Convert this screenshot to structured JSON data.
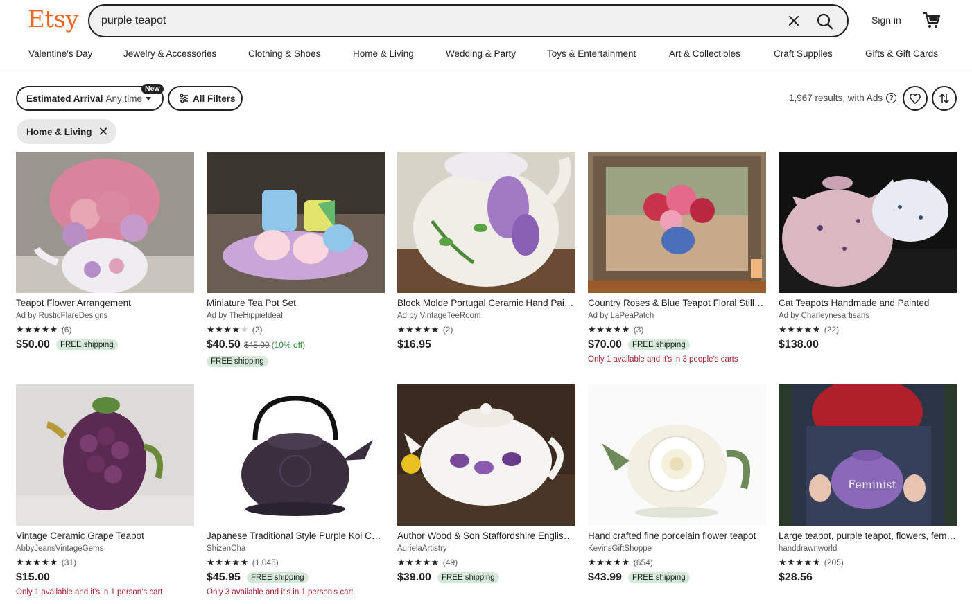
{
  "header": {
    "logo": "Etsy",
    "search_value": "purple teapot",
    "sign_in": "Sign in"
  },
  "nav": [
    "Valentine's Day",
    "Jewelry & Accessories",
    "Clothing & Shoes",
    "Home & Living",
    "Wedding & Party",
    "Toys & Entertainment",
    "Art & Collectibles",
    "Craft Supplies",
    "Gifts & Gift Cards"
  ],
  "filters": {
    "estimated_label": "Estimated Arrival",
    "estimated_value": "Any time",
    "new_badge": "New",
    "all_filters": "All Filters",
    "results_text": "1,967 results, with Ads",
    "chip": "Home & Living"
  },
  "listings": [
    {
      "title": "Teapot Flower Arrangement",
      "shop": "Ad by RusticFlareDesigns",
      "rating": 5,
      "reviews": "(6)",
      "price": "$50.00",
      "free_shipping": "FREE shipping"
    },
    {
      "title": "Miniature Tea Pot Set",
      "shop": "Ad by TheHippieIdeal",
      "rating": 4,
      "reviews": "(2)",
      "price": "$40.50",
      "original_price": "$45.00",
      "discount": "(10% off)",
      "free_shipping": "FREE shipping"
    },
    {
      "title": "Block Molde Portugal Ceramic Hand Painted Teapot",
      "shop": "Ad by VintageTeeRoom",
      "rating": 5,
      "reviews": "(2)",
      "price": "$16.95"
    },
    {
      "title": "Country Roses & Blue Teapot Floral Still Life",
      "shop": "Ad by LaPeaPatch",
      "rating": 5,
      "reviews": "(3)",
      "price": "$70.00",
      "free_shipping": "FREE shipping",
      "availability": "Only 1 available and it's in 3 people's carts"
    },
    {
      "title": "Cat Teapots Handmade and Painted",
      "shop": "Ad by Charleynesartisans",
      "rating": 5,
      "reviews": "(22)",
      "price": "$138.00"
    },
    {
      "title": "Vintage Ceramic Grape Teapot",
      "shop": "AbbyJeansVintageGems",
      "rating": 4.5,
      "reviews": "(31)",
      "price": "$15.00",
      "availability": "Only 1 available and it's in 1 person's cart"
    },
    {
      "title": "Japanese Traditional Style Purple Koi Cast Iron Teapot",
      "shop": "ShizenCha",
      "rating": 5,
      "reviews": "(1,045)",
      "price": "$45.95",
      "free_shipping": "FREE shipping",
      "availability": "Only 3 available and it's in 1 person's cart"
    },
    {
      "title": "Author Wood & Son Staffordshire English Violets Teapot",
      "shop": "AurielaArtistry",
      "rating": 5,
      "reviews": "(49)",
      "price": "$39.00",
      "free_shipping": "FREE shipping"
    },
    {
      "title": "Hand crafted fine porcelain flower teapot",
      "shop": "KevinsGiftShoppe",
      "rating": 5,
      "reviews": "(654)",
      "price": "$43.99",
      "free_shipping": "FREE shipping"
    },
    {
      "title": "Large teapot, purple teapot, flowers, feminist",
      "shop": "handdrawnworld",
      "rating": 5,
      "reviews": "(205)",
      "price": "$28.56"
    }
  ]
}
